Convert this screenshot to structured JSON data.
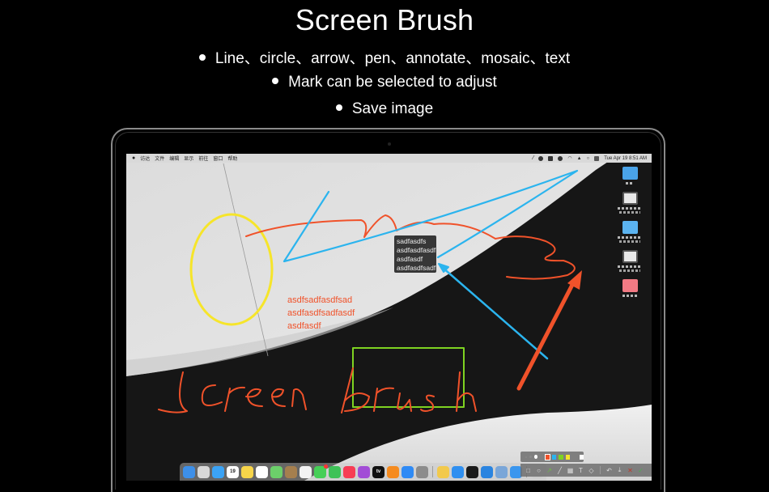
{
  "hero": {
    "title": "Screen Brush",
    "bullets": [
      "Line、circle、arrow、pen、annotate、mosaic、text",
      "Mark can be selected to adjust",
      "Save image"
    ]
  },
  "menubar": {
    "apple_icon": "",
    "items": [
      "访达",
      "文件",
      "编辑",
      "显示",
      "前往",
      "窗口",
      "帮助"
    ],
    "status_icons": [
      "pen-icon",
      "gear-icon",
      "a-icon",
      "face-icon",
      "wifi-icon",
      "user-icon",
      "search-icon",
      "control-center-icon"
    ],
    "clock": "Tue Apr 19  8:51 AM"
  },
  "desktop_icons": [
    {
      "name": "folder-image",
      "color": "#4aa3e8"
    },
    {
      "name": "screenshot-1",
      "color": "#e8e8e8"
    },
    {
      "name": "folder",
      "color": "#5bb3f0"
    },
    {
      "name": "screenshot-2",
      "color": "#e8e8e8"
    },
    {
      "name": "pink-file",
      "color": "#f27a84"
    }
  ],
  "annotations": {
    "selected_text": [
      "sadfasdfs",
      "asdfasdfasdf",
      "asdfasdf",
      "asdfasdfsadf"
    ],
    "orange_text": [
      "asdfsadfasdfsad",
      "asdfasdfsadfasdf",
      "asdfasdf"
    ],
    "handwriting": "Screen brush",
    "colors": {
      "orange": "#f0522a",
      "blue": "#2bb4ee",
      "yellow": "#f6e52a",
      "green": "#7ed321"
    }
  },
  "dock": {
    "apps": [
      {
        "name": "Finder",
        "color": "#3d8fe8"
      },
      {
        "name": "Launchpad",
        "color": "#d8d8d8"
      },
      {
        "name": "Mail",
        "color": "#3ba3f5"
      },
      {
        "name": "Calendar",
        "color": "#ffffff",
        "text": "19"
      },
      {
        "name": "Notes",
        "color": "#f7d54a"
      },
      {
        "name": "Reminders",
        "color": "#ffffff"
      },
      {
        "name": "Maps",
        "color": "#6ccf6a"
      },
      {
        "name": "Contacts",
        "color": "#a57f4e"
      },
      {
        "name": "Photos",
        "color": "#f3f3f3"
      },
      {
        "name": "Messages",
        "color": "#46cf57",
        "badge": "1"
      },
      {
        "name": "FaceTime",
        "color": "#3ec257"
      },
      {
        "name": "Music",
        "color": "#f73c54"
      },
      {
        "name": "Podcasts",
        "color": "#a24dd6"
      },
      {
        "name": "TV",
        "color": "#111111",
        "text": "tv"
      },
      {
        "name": "Books",
        "color": "#f58b1f"
      },
      {
        "name": "App Store",
        "color": "#2e8af5"
      },
      {
        "name": "System Preferences",
        "color": "#8c8c8c"
      },
      {
        "name": "Screen Brush",
        "color": "#f2c94c"
      },
      {
        "name": "Safari",
        "color": "#2f8ff0"
      },
      {
        "name": "Terminal",
        "color": "#1a1a1a"
      },
      {
        "name": "Xcode",
        "color": "#2a84e0"
      },
      {
        "name": "Preview",
        "color": "#7aa6d8"
      },
      {
        "name": "Screen Annotate",
        "color": "#3a96ee"
      },
      {
        "name": "Downloads",
        "color": "#cccccc"
      }
    ]
  },
  "color_picker": {
    "sizes": [
      "small",
      "medium",
      "large"
    ],
    "colors": [
      "#f0522a",
      "#2bb4ee",
      "#7ed321",
      "#f6e52a",
      "#ffffff"
    ],
    "selected_color": "#f0522a"
  },
  "toolbar": {
    "tools": [
      {
        "name": "rectangle",
        "glyph": "□"
      },
      {
        "name": "circle",
        "glyph": "○"
      },
      {
        "name": "arrow",
        "glyph": "↗"
      },
      {
        "name": "line",
        "glyph": "╱"
      },
      {
        "name": "mosaic",
        "glyph": "▦"
      },
      {
        "name": "text",
        "glyph": "T"
      },
      {
        "name": "tag",
        "glyph": "◇"
      }
    ],
    "actions": [
      {
        "name": "undo",
        "glyph": "↶"
      },
      {
        "name": "save",
        "glyph": "⤓"
      },
      {
        "name": "close",
        "glyph": "✕"
      },
      {
        "name": "confirm",
        "glyph": "✓"
      }
    ]
  }
}
